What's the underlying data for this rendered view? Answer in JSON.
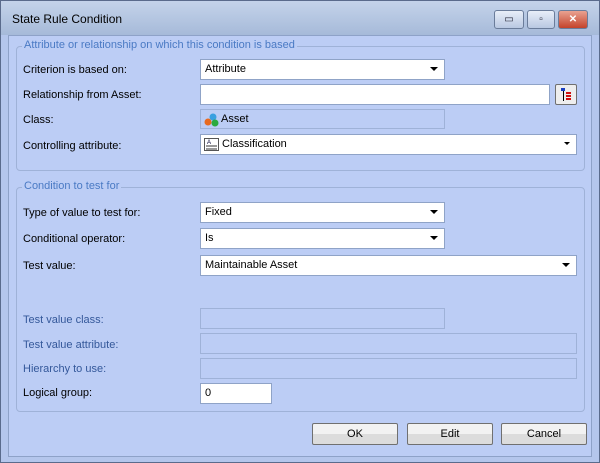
{
  "window": {
    "title": "State Rule Condition",
    "minimize": "▭",
    "maximize": "▫",
    "close": "✕"
  },
  "group1": {
    "title": "Attribute or relationship on which this condition is based",
    "criterion_label": "Criterion is based on:",
    "criterion_value": "Attribute",
    "relationship_label": "Relationship from Asset:",
    "relationship_value": "",
    "class_label": "Class:",
    "class_value": "Asset",
    "controlling_label": "Controlling attribute:",
    "controlling_value": "Classification"
  },
  "group2": {
    "title": "Condition to test for",
    "type_label": "Type of value to test for:",
    "type_value": "Fixed",
    "operator_label": "Conditional operator:",
    "operator_value": "Is",
    "test_value_label": "Test value:",
    "test_value": "Maintainable Asset",
    "test_class_label": "Test value class:",
    "test_attr_label": "Test value attribute:",
    "hierarchy_label": "Hierarchy to use:",
    "logical_label": "Logical group:",
    "logical_value": "0"
  },
  "buttons": {
    "ok": "OK",
    "edit": "Edit",
    "cancel": "Cancel"
  }
}
